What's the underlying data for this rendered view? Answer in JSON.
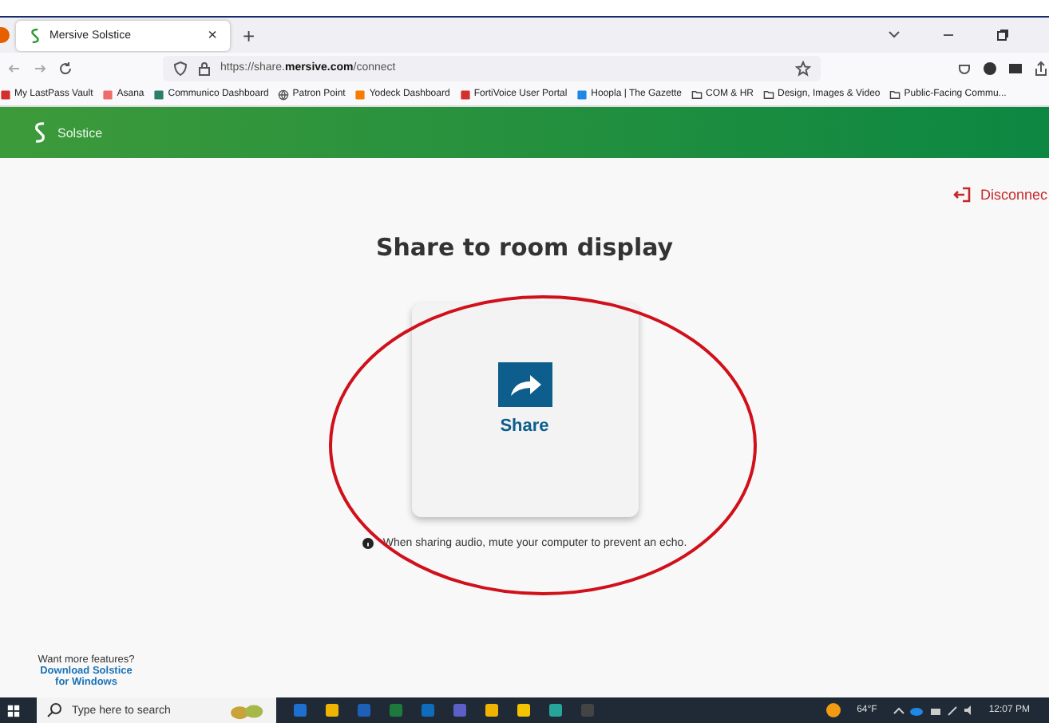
{
  "browser": {
    "tab": {
      "title": "Mersive Solstice",
      "close": "×"
    },
    "new_tab": "+",
    "url": "https://share.**mersive.com**/connect",
    "bookmarks": [
      {
        "label": "My LastPass Vault",
        "kind": "site",
        "color": "#d32f2f"
      },
      {
        "label": "Asana",
        "kind": "site",
        "color": "#f06a6a"
      },
      {
        "label": "Communico Dashboard",
        "kind": "site",
        "color": "#2e7d6b"
      },
      {
        "label": "Patron Point",
        "kind": "globe",
        "color": "#555555"
      },
      {
        "label": "Yodeck Dashboard",
        "kind": "site",
        "color": "#f57c00"
      },
      {
        "label": "FortiVoice User Portal",
        "kind": "site",
        "color": "#d32f2f"
      },
      {
        "label": "Hoopla | The Gazette",
        "kind": "site",
        "color": "#1e88e5"
      },
      {
        "label": "COM & HR",
        "kind": "folder",
        "color": "#444444"
      },
      {
        "label": "Design, Images & Video",
        "kind": "folder",
        "color": "#444444"
      },
      {
        "label": "Public-Facing Commu...",
        "kind": "folder",
        "color": "#444444"
      }
    ]
  },
  "app": {
    "brand": "Solstice",
    "disconnect": "Disconnec",
    "heading": "Share to room display",
    "share_label": "Share",
    "note": "When sharing audio, mute your computer to prevent an echo.",
    "footer_prompt": "Want more features?",
    "download_link": "Download Solstice for Windows"
  },
  "taskbar": {
    "search_placeholder": "Type here to search",
    "weather": "64°F",
    "time": "12:07 PM"
  }
}
